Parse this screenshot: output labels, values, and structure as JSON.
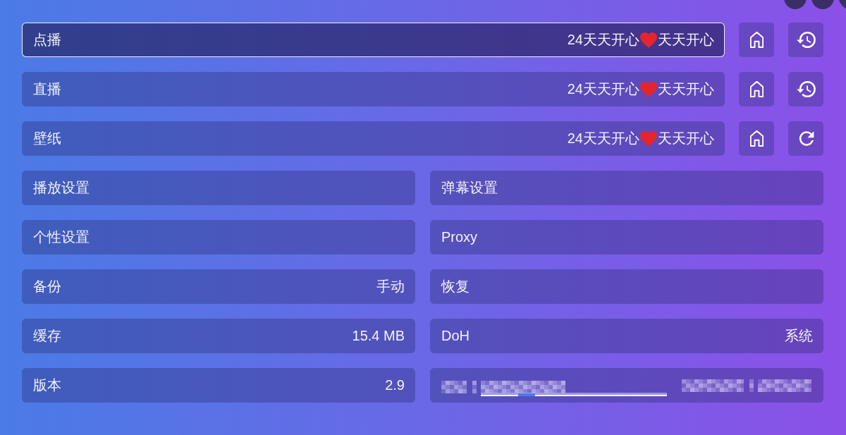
{
  "sources": [
    {
      "label": "点播",
      "value_parts": [
        "24天天开心",
        "天天开心"
      ],
      "selected": true,
      "actions": [
        {
          "kind": "home"
        },
        {
          "kind": "history"
        }
      ]
    },
    {
      "label": "直播",
      "value_parts": [
        "24天天开心",
        "天天开心"
      ],
      "selected": false,
      "actions": [
        {
          "kind": "home"
        },
        {
          "kind": "history"
        }
      ]
    },
    {
      "label": "壁纸",
      "value_parts": [
        "24天天开心",
        "天天开心"
      ],
      "selected": false,
      "actions": [
        {
          "kind": "home"
        },
        {
          "kind": "refresh"
        }
      ]
    }
  ],
  "settings": [
    {
      "kind": "item",
      "label": "播放设置",
      "selected": false
    },
    {
      "kind": "item",
      "label": "弹幕设置",
      "selected": false
    },
    {
      "kind": "item",
      "label": "个性设置",
      "selected": false
    },
    {
      "kind": "item",
      "label": "Proxy",
      "selected": false
    },
    {
      "kind": "item",
      "label": "备份",
      "value": "手动",
      "selected": false
    },
    {
      "kind": "item",
      "label": "恢复",
      "selected": false
    },
    {
      "kind": "item",
      "label": "缓存",
      "value": "15.4 MB",
      "selected": false
    },
    {
      "kind": "item",
      "label": "DoH",
      "value": "系统",
      "selected": false
    },
    {
      "kind": "item",
      "label": "版本",
      "value": "2.9",
      "selected": false
    },
    {
      "kind": "redacted",
      "selected": false
    }
  ]
}
